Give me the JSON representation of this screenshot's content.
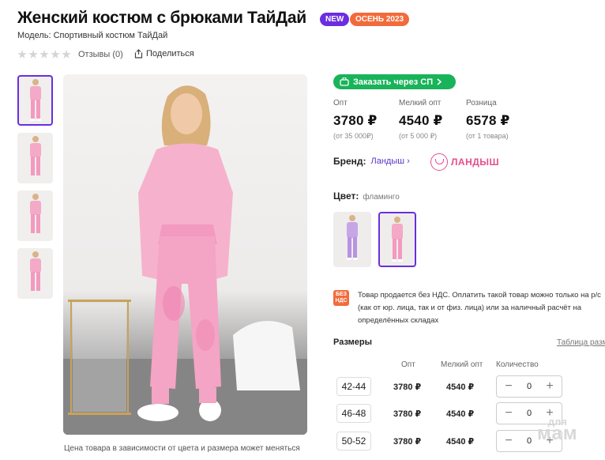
{
  "product": {
    "title": "Женский костюм с брюками ТайДай",
    "badges": {
      "new": "NEW",
      "season": "ОСЕНЬ 2023"
    },
    "model": "Модель: Спортивный костюм ТайДай",
    "reviews": "Отзывы (0)",
    "share": "Поделиться",
    "rating_stars_filled": 0,
    "rating_stars_total": 5
  },
  "gallery": {
    "thumbnails": [
      "thumb-1",
      "thumb-2",
      "thumb-3",
      "thumb-4"
    ],
    "active_thumbnail": 0,
    "caption": "Цена товара в зависимости от цвета и размера может меняться"
  },
  "order": {
    "sp_button": "Заказать через СП"
  },
  "prices": [
    {
      "label": "Опт",
      "value": "3780 ₽",
      "note": "(от 35 000₽)"
    },
    {
      "label": "Мелкий опт",
      "value": "4540 ₽",
      "note": "(от 5 000 ₽)"
    },
    {
      "label": "Розница",
      "value": "6578 ₽",
      "note": "(от 1 товара)"
    }
  ],
  "brand": {
    "label": "Бренд:",
    "link": "Ландыш ›",
    "logo_text": "ЛАНДЫШ"
  },
  "color": {
    "label": "Цвет:",
    "value": "фламинго",
    "swatches": [
      "лаванда",
      "фламинго"
    ],
    "active": 1
  },
  "nds": {
    "icon": "БЕЗ НДС",
    "text": "Товар продается без НДС. Оплатить такой товар можно только на р/с (как от юр. лица, так и от физ. лица) или за наличный расчёт на определённых складах"
  },
  "sizes": {
    "title": "Размеры",
    "table_link": "Таблица разм",
    "headers": {
      "opt": "Опт",
      "small_opt": "Мелкий опт",
      "quantity": "Количество"
    },
    "rows": [
      {
        "size": "42-44",
        "opt": "3780 ₽",
        "small_opt": "4540 ₽",
        "qty": "0",
        "minus": "−",
        "plus": "+"
      },
      {
        "size": "46-48",
        "opt": "3780 ₽",
        "small_opt": "4540 ₽",
        "qty": "0",
        "minus": "−",
        "plus": "+"
      },
      {
        "size": "50-52",
        "opt": "3780 ₽",
        "small_opt": "4540 ₽",
        "qty": "0",
        "minus": "−",
        "plus": "+"
      }
    ]
  },
  "watermark": {
    "top": "для",
    "bottom": "мам"
  },
  "colors": {
    "accent": "#6a2ee0",
    "sp_green": "#19b35a",
    "season_orange": "#f26b3a",
    "brand_pink": "#e64d8e",
    "suit_pink": "#f4a9c6"
  }
}
